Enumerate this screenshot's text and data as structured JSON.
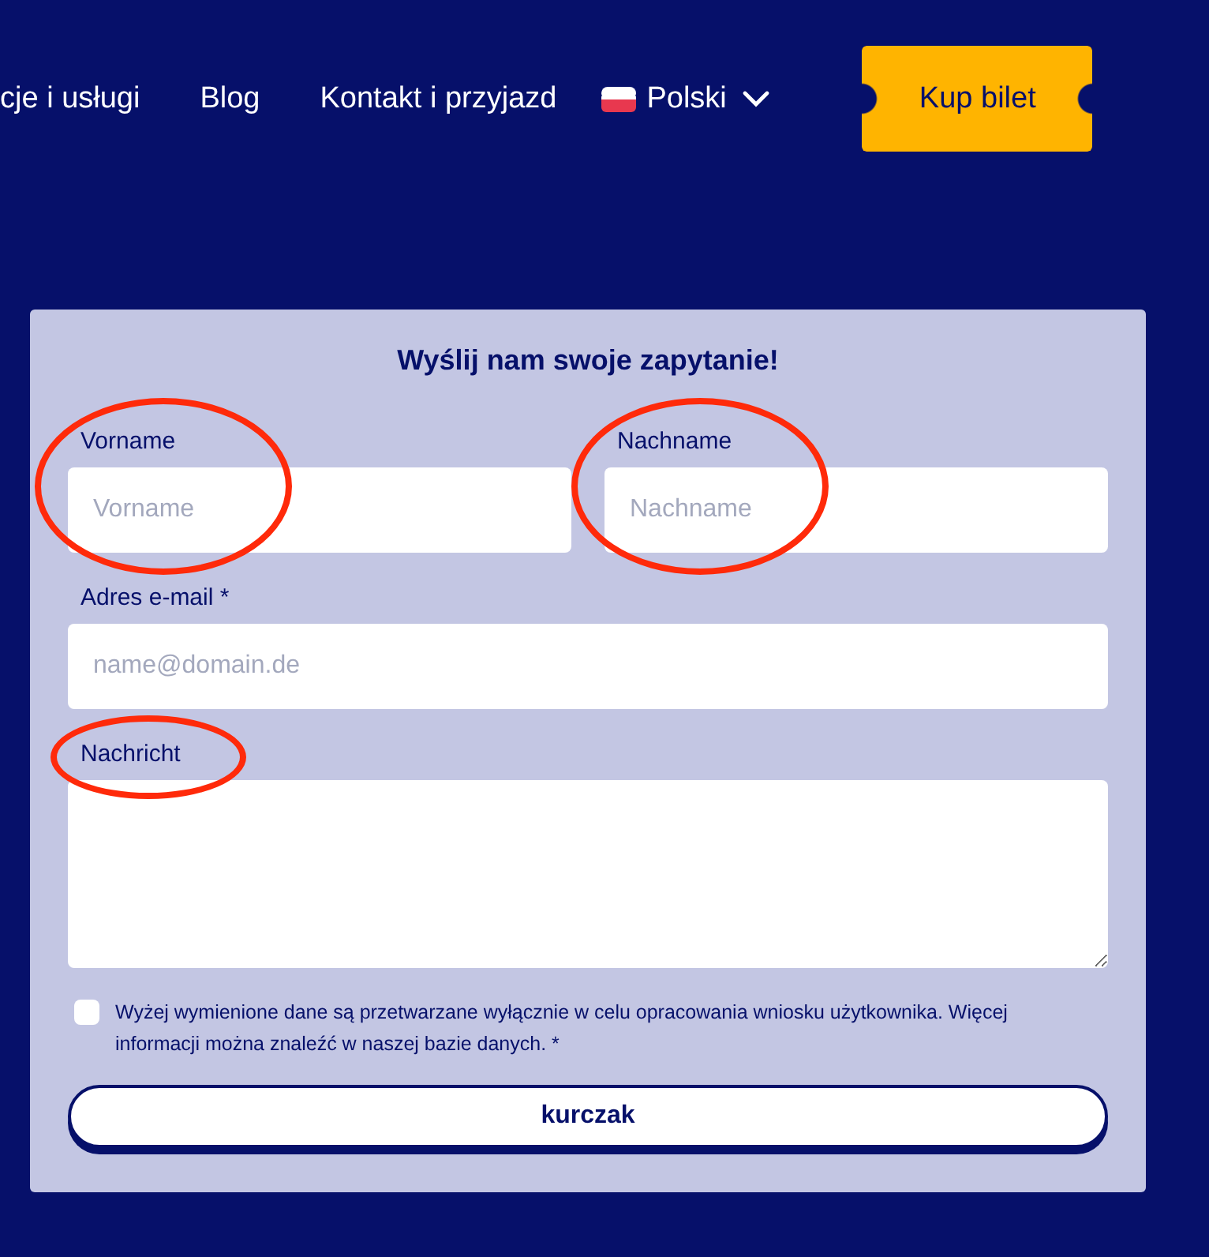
{
  "nav": {
    "items": [
      "cje i usługi",
      "Blog",
      "Kontakt i przyjazd"
    ],
    "language": "Polski",
    "ticket_button": "Kup bilet"
  },
  "form": {
    "title": "Wyślij nam swoje zapytanie!",
    "fields": [
      {
        "kind": "input",
        "label": "Vorname",
        "placeholder": "Vorname",
        "half": true,
        "circled": true
      },
      {
        "kind": "input",
        "label": "Nachname",
        "placeholder": "Nachname",
        "half": true,
        "circled": true
      },
      {
        "kind": "input",
        "label": "Adres e-mail *",
        "placeholder": "name@domain.de",
        "half": false
      },
      {
        "kind": "textarea",
        "label": "Nachricht",
        "half": false,
        "circled": true
      }
    ],
    "consent": {
      "checked": false,
      "text": "Wyżej wymienione dane są przetwarzane wyłącznie w celu opracowania wniosku użytkownika. Więcej informacji można znaleźć w naszej bazie danych. *"
    },
    "submit": "kurczak"
  }
}
